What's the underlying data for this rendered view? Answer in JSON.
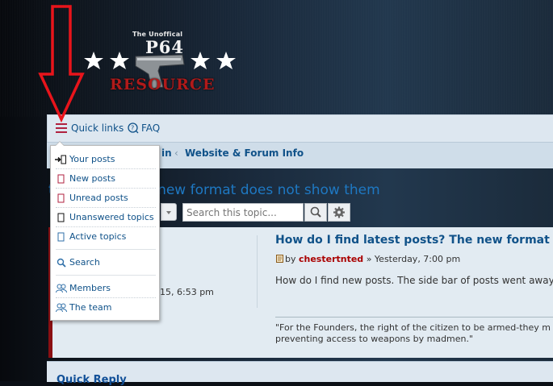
{
  "logo": {
    "tagline": "The Unoffical",
    "name": "P64",
    "word": "RESOURCE"
  },
  "navbar": {
    "quick_links": "Quick links",
    "faq": "FAQ"
  },
  "breadcrumb": {
    "partial": "in",
    "forum": "Website & Forum Info"
  },
  "topic": {
    "title": "test posts? The new format does not show them"
  },
  "search": {
    "placeholder": "Search this topic..."
  },
  "post": {
    "date_fragment": "15, 6:53 pm",
    "title": "How do I find latest posts? The new format",
    "by_prefix": "by",
    "author": "chestertnted",
    "time": "» Yesterday, 7:00 pm",
    "body": "How do I find new posts.  The side bar of posts went away.",
    "signature_line1": "\"For the Founders, the right of the citizen to be armed-they m",
    "signature_line2": "preventing access to weapons by madmen.\""
  },
  "quick_reply": "Quick Reply",
  "quick_links_menu": {
    "items": [
      {
        "label": "Your posts",
        "icon": "arrow-document-icon"
      },
      {
        "label": "New posts",
        "icon": "document-red-icon"
      },
      {
        "label": "Unread posts",
        "icon": "document-red-icon"
      },
      {
        "label": "Unanswered topics",
        "icon": "document-black-icon"
      },
      {
        "label": "Active topics",
        "icon": "document-blue-icon"
      },
      {
        "label": "Search",
        "icon": "search-icon"
      },
      {
        "label": "Members",
        "icon": "members-icon"
      },
      {
        "label": "The team",
        "icon": "team-icon"
      }
    ]
  },
  "colors": {
    "link": "#105289",
    "accent_red": "#b0213f",
    "post_border": "#8a0f12",
    "arrow": "#e8141b"
  }
}
